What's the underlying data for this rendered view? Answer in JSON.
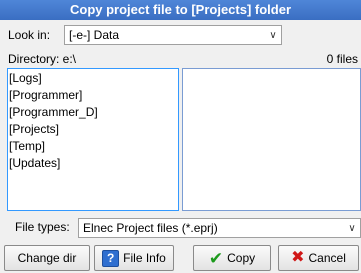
{
  "window": {
    "title": "Copy project file to [Projects] folder"
  },
  "look_in": {
    "label": "Look in:",
    "value": "[-e-]  Data"
  },
  "directory": {
    "label": "Directory: e:\\",
    "files_count": "0 files"
  },
  "directory_list": {
    "items": [
      "[Logs]",
      "[Programmer]",
      "[Programmer_D]",
      "[Projects]",
      "[Temp]",
      "[Updates]"
    ]
  },
  "file_types": {
    "label": "File types:",
    "value": "Elnec Project files (*.eprj)"
  },
  "buttons": {
    "change_dir": "Change dir",
    "file_info": "File Info",
    "copy": "Copy",
    "cancel": "Cancel"
  },
  "icons": {
    "help_glyph": "?",
    "check_glyph": "✔",
    "cancel_glyph": "✖",
    "dropdown_glyph": "∨"
  }
}
